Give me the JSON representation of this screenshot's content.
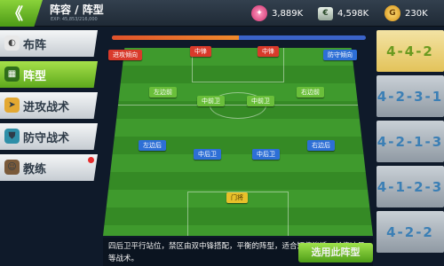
{
  "header": {
    "back_label": "《",
    "title": "阵容 / 阵型",
    "exp": "EXP: 45,853/216,000"
  },
  "currencies": [
    {
      "icon": "gem-icon",
      "value": "3,889K",
      "color": "#d0306e"
    },
    {
      "icon": "cash-icon",
      "value": "4,598K",
      "color": "#97a89a"
    },
    {
      "icon": "coin-icon",
      "value": "230K",
      "color": "#d48c10"
    }
  ],
  "sidebar": {
    "items": [
      {
        "label": "布阵",
        "icon": "tactics-board-icon",
        "active": false
      },
      {
        "label": "阵型",
        "icon": "formation-icon",
        "active": true
      },
      {
        "label": "进攻战术",
        "icon": "attack-icon",
        "active": false
      },
      {
        "label": "防守战术",
        "icon": "defense-icon",
        "active": false
      },
      {
        "label": "教练",
        "icon": "coach-icon",
        "active": false,
        "notification": true
      }
    ]
  },
  "pitch": {
    "tendency_left": "进攻倾向",
    "tendency_right": "防守倾向",
    "attack_ratio": 0.5,
    "players": {
      "cf_left": "中锋",
      "cf_right": "中锋",
      "lm": "左边前",
      "cm_left": "中前卫",
      "cm_right": "中前卫",
      "rm": "右边前",
      "lb": "左边后",
      "cb_left": "中后卫",
      "cb_right": "中后卫",
      "rb": "右边后",
      "gk": "门将"
    }
  },
  "description": "四后卫平行站位，禁区由双中锋搭配，平衡的阵型，适合短传渗透、长传冲吊等战术。",
  "select_button": "选用此阵型",
  "formations": [
    {
      "label": "4-4-2",
      "active": true
    },
    {
      "label": "4-2-3-1",
      "active": false
    },
    {
      "label": "4-2-1-3",
      "active": false
    },
    {
      "label": "4-1-2-3",
      "active": false
    },
    {
      "label": "4-2-2",
      "active": false
    }
  ],
  "colors": {
    "accent": "#6abf3a",
    "attack": "#d93a2b",
    "defense": "#2d6fd6"
  }
}
